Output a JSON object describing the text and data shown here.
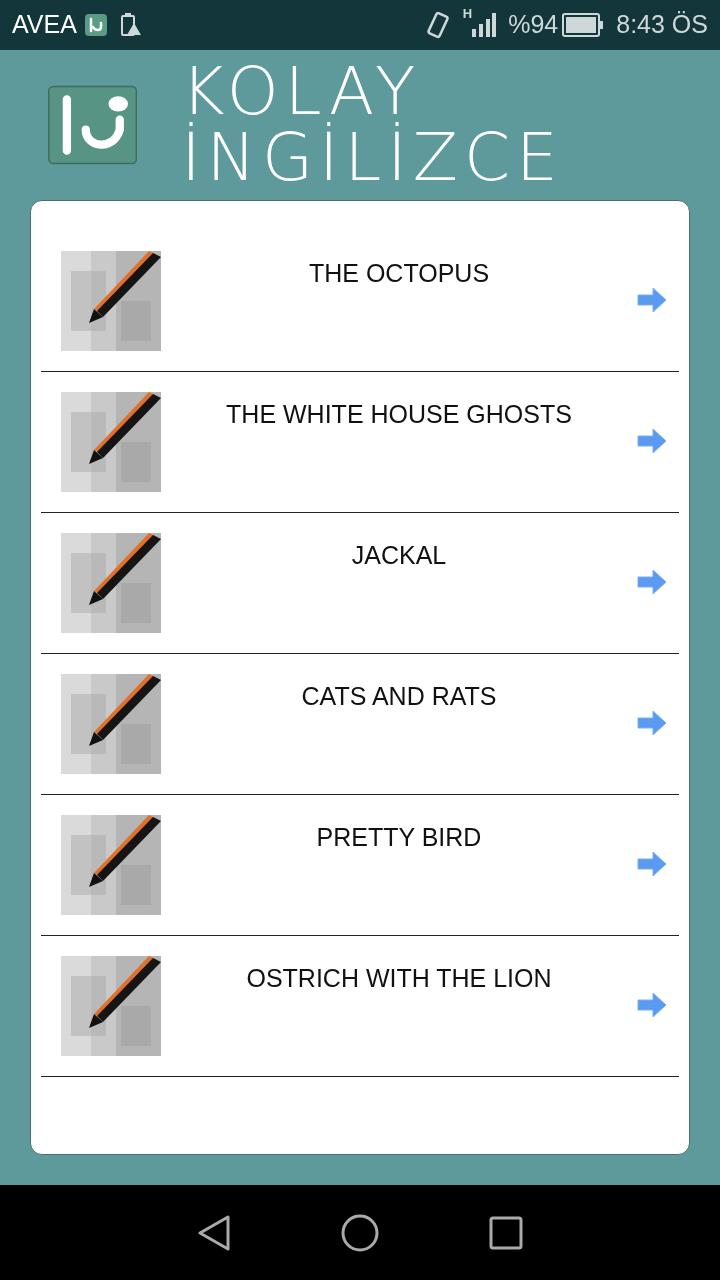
{
  "status_bar": {
    "carrier": "AVEA",
    "network": "H",
    "battery_text": "%94",
    "time": "8:43 ÖS"
  },
  "header": {
    "title": "KOLAY İNGİLİZCE"
  },
  "stories": [
    {
      "title": "THE OCTOPUS"
    },
    {
      "title": "THE WHITE HOUSE GHOSTS"
    },
    {
      "title": "JACKAL"
    },
    {
      "title": "CATS AND RATS"
    },
    {
      "title": "PRETTY BIRD"
    },
    {
      "title": "OSTRICH WITH THE LION"
    }
  ]
}
